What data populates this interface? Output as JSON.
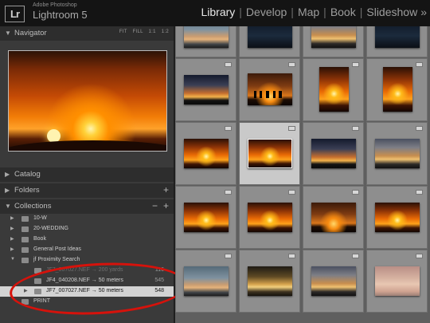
{
  "app": {
    "adobe_label": "Adobe Photoshop",
    "product_name": "Lightroom 5",
    "logo_text": "Lr"
  },
  "modules": [
    "Library",
    "Develop",
    "Map",
    "Book",
    "Slideshow"
  ],
  "module_active": "Library",
  "module_more": "»",
  "left_panel": {
    "navigator": {
      "title": "Navigator",
      "zoom_options": [
        "FIT",
        "FILL",
        "1:1",
        "1:2"
      ]
    },
    "catalog": {
      "title": "Catalog"
    },
    "folders": {
      "title": "Folders",
      "add": "+"
    },
    "collections": {
      "title": "Collections",
      "remove": "−",
      "add": "+",
      "items": [
        {
          "label": "10-W"
        },
        {
          "label": "20-WEDDING"
        },
        {
          "label": "Book"
        },
        {
          "label": "General Post Ideas"
        },
        {
          "label": "jf Proximity Search"
        }
      ],
      "sub_items": [
        {
          "label": "JF7_007027.NEF → 200 yards",
          "count": "116"
        },
        {
          "label": "JF4_040208.NEF → 50 meters",
          "count": "545"
        },
        {
          "label": "JF7_007027.NEF → 50 meters",
          "count": "548"
        }
      ],
      "after_items": [
        {
          "label": "PRINT"
        }
      ]
    }
  },
  "grid": {
    "selected_index": 9,
    "rows": 5,
    "cols": 4
  },
  "colors": {
    "annotation_ring": "#d6120b",
    "topbar_bg": "#141414",
    "panel_bg": "#3a3a3a",
    "grid_bg": "#5f5f5f",
    "cell_bg": "#8e8e8e",
    "cell_selected_bg": "#c9c9c9"
  }
}
